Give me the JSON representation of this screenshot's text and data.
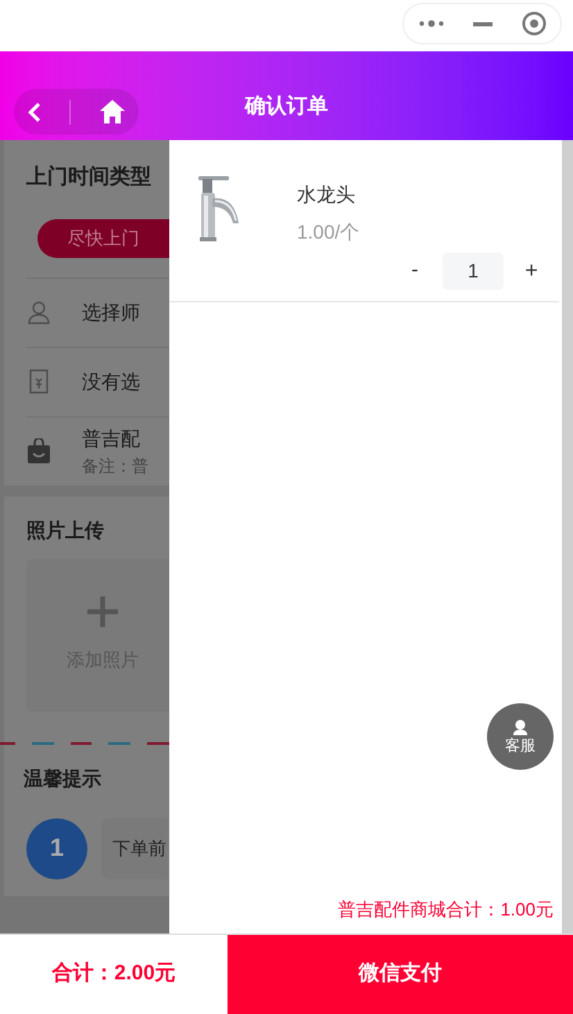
{
  "header": {
    "title": "确认订单"
  },
  "page": {
    "time_type": {
      "title": "上门时间类型",
      "options": [
        {
          "label": "尽快上门",
          "selected": true
        }
      ]
    },
    "rows": [
      {
        "kind": "master",
        "text": "选择师"
      },
      {
        "kind": "coupon",
        "text": "没有选"
      },
      {
        "kind": "store",
        "text": "普吉配",
        "note": "备注：普"
      }
    ],
    "photos": {
      "title": "照片上传",
      "add_label": "添加照片"
    },
    "tips": {
      "title": "温馨提示",
      "items": [
        {
          "number": "1",
          "text": "下单前"
        }
      ]
    }
  },
  "drawer": {
    "items": [
      {
        "name": "水龙头",
        "price": "1.00/个",
        "minus": "-",
        "quantity": "1",
        "plus": "+"
      }
    ],
    "service_label": "客服",
    "subtotal": "普吉配件商城合计：1.00元"
  },
  "footer": {
    "total": "合计：2.00元",
    "pay_button": "微信支付"
  }
}
